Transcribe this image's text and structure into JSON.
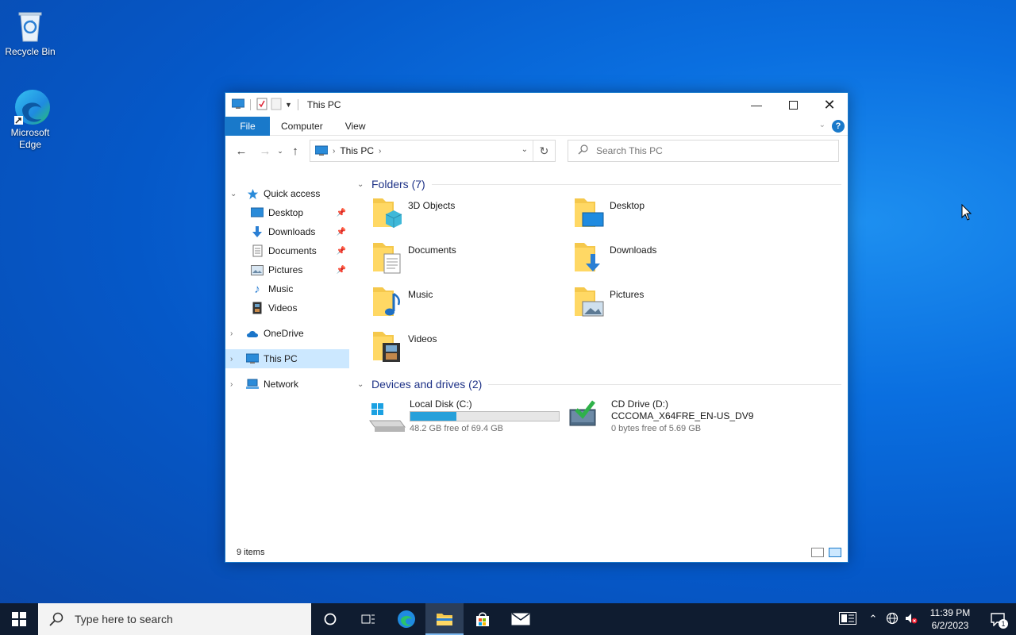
{
  "desktop": {
    "icons": [
      {
        "label": "Recycle Bin",
        "icon": "recycle-bin-icon"
      },
      {
        "label": "Microsoft Edge",
        "icon": "edge-icon"
      }
    ]
  },
  "window": {
    "title": "This PC",
    "ribbon_tabs": [
      "File",
      "Computer",
      "View"
    ],
    "help": "?",
    "address": {
      "crumb": "This PC"
    },
    "search": {
      "placeholder": "Search This PC"
    },
    "nav_pane": {
      "quick_access": "Quick access",
      "quick_items": [
        {
          "label": "Desktop",
          "pinned": true
        },
        {
          "label": "Downloads",
          "pinned": true
        },
        {
          "label": "Documents",
          "pinned": true
        },
        {
          "label": "Pictures",
          "pinned": true
        },
        {
          "label": "Music",
          "pinned": false
        },
        {
          "label": "Videos",
          "pinned": false
        }
      ],
      "onedrive": "OneDrive",
      "this_pc": "This PC",
      "network": "Network"
    },
    "folders_header": "Folders (7)",
    "folders": [
      "3D Objects",
      "Desktop",
      "Documents",
      "Downloads",
      "Music",
      "Pictures",
      "Videos"
    ],
    "drives_header": "Devices and drives (2)",
    "drives": [
      {
        "name": "Local Disk (C:)",
        "free": "48.2 GB free of 69.4 GB",
        "used_fraction": 0.31
      },
      {
        "name": "CD Drive (D:)",
        "label": "CCCOMA_X64FRE_EN-US_DV9",
        "free": "0 bytes free of 5.69 GB"
      }
    ],
    "status": "9 items"
  },
  "taskbar": {
    "search_placeholder": "Type here to search",
    "time": "11:39 PM",
    "date": "6/2/2023",
    "notif_count": "1"
  }
}
